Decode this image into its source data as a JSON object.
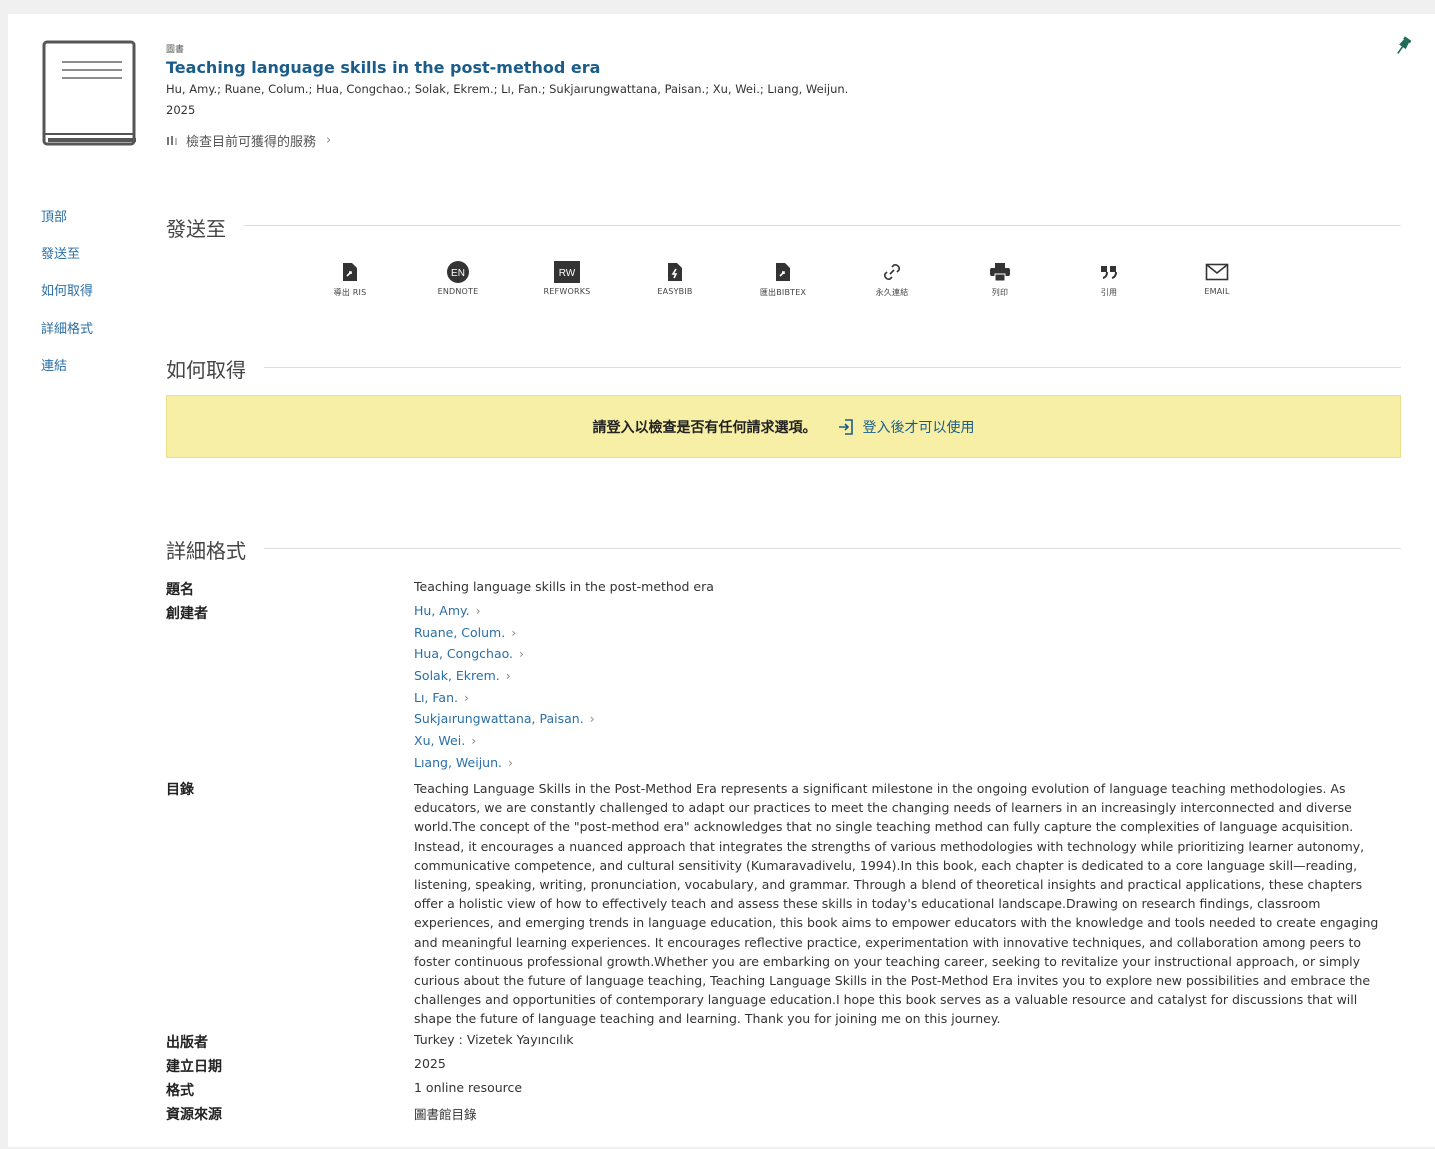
{
  "record": {
    "type_label": "圖書",
    "title": "Teaching language skills in the post-method era",
    "authors_line": "Hu, Amy.; Ruane, Colum.; Hua, Congchao.; Solak, Ekrem.; Lı, Fan.; Sukjaırungwattana, Paisan.; Xu, Wei.; Lıang, Weijun.",
    "year": "2025",
    "availability_text": "檢查目前可獲得的服務"
  },
  "side_nav": {
    "items": [
      "頂部",
      "發送至",
      "如何取得",
      "詳細格式",
      "連結"
    ]
  },
  "send_to": {
    "title": "發送至",
    "actions": [
      {
        "label": "導出 RIS",
        "icon": "ris-export-icon"
      },
      {
        "label": "ENDNOTE",
        "icon": "endnote-icon",
        "badge": "EN"
      },
      {
        "label": "REFWORKS",
        "icon": "refworks-icon",
        "badge": "RW"
      },
      {
        "label": "EASYBIB",
        "icon": "easybib-icon"
      },
      {
        "label": "匯出BIBTEX",
        "icon": "bibtex-export-icon"
      },
      {
        "label": "永久連結",
        "icon": "permalink-icon"
      },
      {
        "label": "列印",
        "icon": "print-icon"
      },
      {
        "label": "引用",
        "icon": "citation-icon"
      },
      {
        "label": "EMAIL",
        "icon": "email-icon"
      }
    ]
  },
  "how_to_get": {
    "title": "如何取得",
    "message": "請登入以檢查是否有任何請求選項。",
    "login_link": "登入後才可以使用"
  },
  "details": {
    "title": "詳細格式",
    "title_label": "題名",
    "title_value": "Teaching language skills in the post-method era",
    "creator_label": "創建者",
    "creators": [
      "Hu, Amy.",
      "Ruane, Colum.",
      "Hua, Congchao.",
      "Solak, Ekrem.",
      "Lı, Fan.",
      "Sukjaırungwattana, Paisan.",
      "Xu, Wei.",
      "Lıang, Weijun."
    ],
    "toc_label": "目錄",
    "toc_lines": [
      "Teaching Language Skills in the Post-Method Era represents a significant milestone in the ongoing evolution of language teaching methodologies. As",
      "educators, we are constantly challenged to adapt our practices to meet the changing needs of learners in an increasingly interconnected and diverse",
      "world.The concept of the \"post-method era\" acknowledges that no single teaching method can fully capture the complexities of language acquisition.",
      "Instead, it encourages a nuanced approach that integrates the strengths of various methodologies with technology while prioritizing learner autonomy,",
      "communicative competence, and cultural sensitivity (Kumaravadivelu, 1994).In this book, each chapter is dedicated to a core language skill—reading,",
      "listening, speaking, writing, pronunciation, vocabulary, and grammar. Through a blend of theoretical insights and practical applications, these chapters",
      "offer a holistic view of how to effectively teach and assess these skills in today's educational landscape.Drawing on research findings, classroom",
      "experiences, and emerging trends in language education, this book aims to empower educators with the knowledge and tools needed to create engaging",
      "and meaningful learning experiences. It encourages reflective practice, experimentation with innovative techniques, and collaboration among peers to",
      "foster continuous professional growth.Whether you are embarking on your teaching career, seeking to revitalize your instructional approach, or simply",
      "curious about the future of language teaching, Teaching Language Skills in the Post-Method Era invites you to explore new possibilities and embrace the",
      "challenges and opportunities of contemporary language education.I hope this book serves as a valuable resource and catalyst for discussions that will",
      "shape the future of language teaching and learning. Thank you for joining me on this journey."
    ],
    "publisher_label": "出版者",
    "publisher_value": "Turkey : Vizetek Yayıncılık",
    "created_label": "建立日期",
    "created_value": "2025",
    "format_label": "格式",
    "format_value": "1 online resource",
    "source_label": "資源來源",
    "source_value": "圖書館目錄"
  },
  "colors": {
    "link": "#2b6fa6",
    "title": "#1a5d8a",
    "notice_bg": "#f7efa5",
    "pin": "#1f6b5a"
  }
}
